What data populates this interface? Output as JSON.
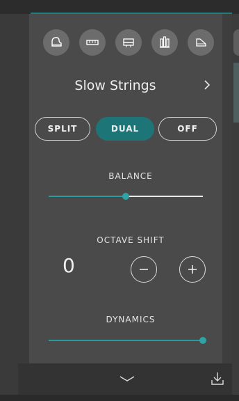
{
  "panel": {
    "voice_name": "Slow Strings",
    "mode_buttons": [
      {
        "label": "SPLIT"
      },
      {
        "label": "DUAL"
      },
      {
        "label": "OFF"
      }
    ],
    "active_mode": "DUAL",
    "balance": {
      "label": "BALANCE",
      "value": 0.5
    },
    "octave_shift": {
      "label": "OCTAVE SHIFT",
      "value": "0"
    },
    "dynamics": {
      "label": "DYNAMICS",
      "value": 1.0
    }
  },
  "voice_icons": [
    "grand-piano-icon",
    "electric-piano-icon",
    "organ-icon",
    "pipe-organ-icon",
    "harpsichord-icon"
  ],
  "colors": {
    "accent": "#1e7577",
    "slider_fill": "#2a9a9c",
    "panel_bg": "#4a4a4a"
  }
}
